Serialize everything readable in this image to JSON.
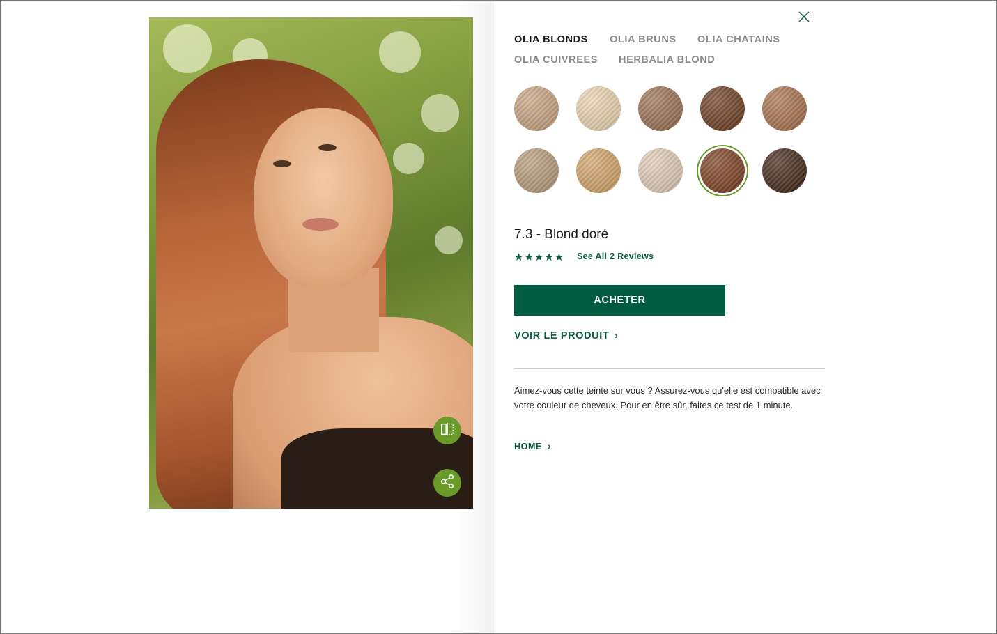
{
  "tabs": [
    {
      "label": "OLIA BLONDS",
      "active": true
    },
    {
      "label": "OLIA BRUNS",
      "active": false
    },
    {
      "label": "OLIA CHATAINS",
      "active": false
    },
    {
      "label": "OLIA CUIVREES",
      "active": false
    },
    {
      "label": "HERBALIA BLOND",
      "active": false
    }
  ],
  "swatches": [
    {
      "color": "#c9a37e",
      "selected": false
    },
    {
      "color": "#ecd6b0",
      "selected": false
    },
    {
      "color": "#9a6e50",
      "selected": false
    },
    {
      "color": "#6b3a1c",
      "selected": false
    },
    {
      "color": "#a8704a",
      "selected": false
    },
    {
      "color": "#b89a78",
      "selected": false
    },
    {
      "color": "#d4a468",
      "selected": false
    },
    {
      "color": "#e3cdb6",
      "selected": false
    },
    {
      "color": "#7a3c1c",
      "selected": true
    },
    {
      "color": "#3f2212",
      "selected": false
    }
  ],
  "product": {
    "shade_name": "7.3 - Blond doré",
    "stars": "★★★★★",
    "rating": 5,
    "reviews_link": "See All 2 Reviews",
    "buy_label": "ACHETER",
    "view_product_label": "VOIR LE PRODUIT",
    "description": "Aimez-vous cette teinte sur vous ? Assurez-vous qu'elle est compatible avec votre couleur de cheveux. Pour en être sûr, faites ce test de 1 minute.",
    "home_label": "HOME"
  },
  "icons": {
    "close": "close-icon",
    "compare": "compare-icon",
    "share": "share-icon",
    "chevron": "chevron-right-icon"
  },
  "colors": {
    "brand_green": "#005b41",
    "accent_green": "#6a9a2a",
    "link_green": "#0d5c45"
  }
}
